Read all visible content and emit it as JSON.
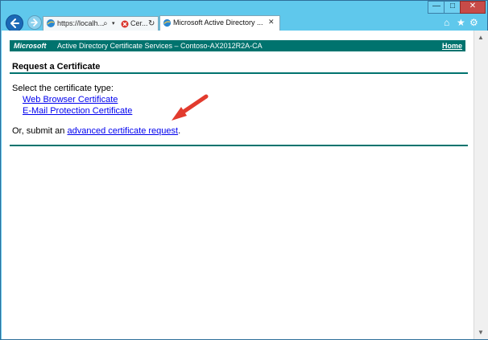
{
  "browser": {
    "address": {
      "url_text": "https://localh...",
      "search_icon": "search-icon",
      "dropdown_icon": "chevron-down-icon",
      "cert_error_label": "Cer...",
      "refresh_icon": "refresh-icon"
    },
    "tab": {
      "title": "Microsoft Active Directory ...",
      "close_glyph": "✕"
    },
    "controls": {
      "minimize_glyph": "—",
      "maximize_glyph": "□",
      "close_glyph": "✕"
    }
  },
  "page": {
    "banner": {
      "brand": "Microsoft",
      "service": "Active Directory Certificate Services  –  Contoso-AX2012R2A-CA",
      "home": "Home"
    },
    "title": "Request a Certificate",
    "select_prompt": "Select the certificate type:",
    "certificate_types": [
      "Web Browser Certificate",
      "E-Mail Protection Certificate"
    ],
    "submit_prefix": "Or, submit an ",
    "advanced_link": "advanced certificate request",
    "submit_suffix": "."
  },
  "colors": {
    "banner": "#00736e",
    "link": "#0000ee",
    "arrow": "#e23b2e",
    "browser_chrome": "#5fc8ec"
  }
}
